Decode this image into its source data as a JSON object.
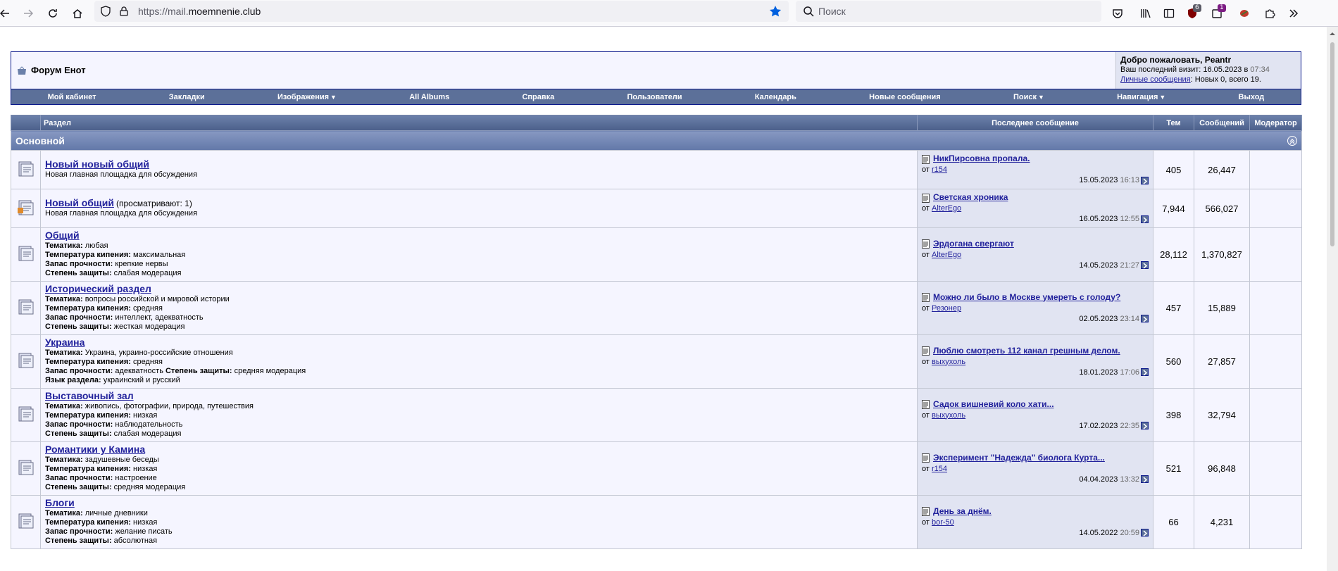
{
  "browser": {
    "url_prefix": "https://mail.",
    "url_domain": "moemnenie.club",
    "search_placeholder": "Поиск",
    "badge_1": "6",
    "badge_2": "1"
  },
  "header": {
    "forum_title": "Форум Енот",
    "welcome_line": "Добро пожаловать, Peantr",
    "last_visit_prefix": "Ваш последний визит: 16.05.2023 в ",
    "last_visit_time": "07:34",
    "pm_link": "Личные сообщения",
    "pm_counts": ": Новых 0, всего 19."
  },
  "navbar": [
    {
      "label": "Мой кабинет",
      "dropdown": false
    },
    {
      "label": "Закладки",
      "dropdown": false
    },
    {
      "label": "Изображения",
      "dropdown": true
    },
    {
      "label": "All Albums",
      "dropdown": false
    },
    {
      "label": "Справка",
      "dropdown": false
    },
    {
      "label": "Пользователи",
      "dropdown": false
    },
    {
      "label": "Календарь",
      "dropdown": false
    },
    {
      "label": "Новые сообщения",
      "dropdown": false
    },
    {
      "label": "Поиск",
      "dropdown": true
    },
    {
      "label": "Навигация",
      "dropdown": true
    },
    {
      "label": "Выход",
      "dropdown": false
    }
  ],
  "table": {
    "columns": {
      "section": "Раздел",
      "last_post": "Последнее сообщение",
      "threads": "Тем",
      "posts": "Сообщений",
      "moderator": "Модератор"
    },
    "category": "Основной",
    "by_prefix": "от ",
    "forums": [
      {
        "name": "Новый новый общий",
        "viewers": "",
        "details": [
          {
            "label": "",
            "value": "Новая главная площадка для обсуждения"
          }
        ],
        "last_title": "НикПирсовна пропала.",
        "last_user": "r154",
        "last_date": "15.05.2023",
        "last_time": "16:13",
        "threads": "405",
        "posts": "26,447"
      },
      {
        "name": "Новый общий",
        "viewers": "(просматривают: 1)",
        "details": [
          {
            "label": "",
            "value": "Новая главная площадка для обсуждения"
          }
        ],
        "last_title": "Светская хроника",
        "last_user": "AlterEgo",
        "last_date": "16.05.2023",
        "last_time": "12:55",
        "threads": "7,944",
        "posts": "566,027"
      },
      {
        "name": "Общий",
        "viewers": "",
        "details": [
          {
            "label": "Тематика:",
            "value": "любая"
          },
          {
            "label": "Температура кипения:",
            "value": "максимальная"
          },
          {
            "label": "Запас прочности:",
            "value": "крепкие нервы"
          },
          {
            "label": "Степень защиты:",
            "value": "слабая модерация"
          }
        ],
        "last_title": "Эрдогана свергают",
        "last_user": "AlterEgo",
        "last_date": "14.05.2023",
        "last_time": "21:27",
        "threads": "28,112",
        "posts": "1,370,827"
      },
      {
        "name": "Исторический раздел",
        "viewers": "",
        "details": [
          {
            "label": "Тематика:",
            "value": "вопросы российской и мировой истории"
          },
          {
            "label": "Температура кипения:",
            "value": "средняя"
          },
          {
            "label": "Запас прочности:",
            "value": "интеллект, адекватность"
          },
          {
            "label": "Степень защиты:",
            "value": "жесткая модерация"
          }
        ],
        "last_title": "Можно ли было в Москве умереть с голоду?",
        "last_user": "Резонер",
        "last_date": "02.05.2023",
        "last_time": "23:14",
        "threads": "457",
        "posts": "15,889"
      },
      {
        "name": "Украина",
        "viewers": "",
        "details": [
          {
            "label": "Тематика:",
            "value": "Украина, украино-российские отношения"
          },
          {
            "label": "Температура кипения:",
            "value": "средняя"
          },
          {
            "label": "Запас прочности:",
            "value": "адекватность",
            "label2": "Степень защиты:",
            "value2": "средняя модерация"
          },
          {
            "label": "Язык раздела:",
            "value": "украинский и русский"
          }
        ],
        "last_title": "Люблю смотреть 112 канал грешным делом.",
        "last_user": "выхухоль",
        "last_date": "18.01.2023",
        "last_time": "17:06",
        "threads": "560",
        "posts": "27,857"
      },
      {
        "name": "Выставочный зал",
        "viewers": "",
        "details": [
          {
            "label": "Тематика:",
            "value": "живопись, фотографии, природа, путешествия"
          },
          {
            "label": "Температура кипения:",
            "value": "низкая"
          },
          {
            "label": "Запас прочности:",
            "value": "наблюдательность"
          },
          {
            "label": "Степень защиты:",
            "value": "слабая модерация"
          }
        ],
        "last_title": "Садок вишневий коло хати...",
        "last_user": "выхухоль",
        "last_date": "17.02.2023",
        "last_time": "22:35",
        "threads": "398",
        "posts": "32,794"
      },
      {
        "name": "Романтики у Камина",
        "viewers": "",
        "details": [
          {
            "label": "Тематика:",
            "value": "задушевные беседы"
          },
          {
            "label": "Температура кипения:",
            "value": "низкая"
          },
          {
            "label": "Запас прочности:",
            "value": "настроение"
          },
          {
            "label": "Степень защиты:",
            "value": "средняя модерация"
          }
        ],
        "last_title": "Эксперимент \"Надежда\" биолога Курта...",
        "last_user": "r154",
        "last_date": "04.04.2023",
        "last_time": "13:32",
        "threads": "521",
        "posts": "96,848"
      },
      {
        "name": "Блоги",
        "viewers": "",
        "details": [
          {
            "label": "Тематика:",
            "value": "личные дневники"
          },
          {
            "label": "Температура кипения:",
            "value": "низкая"
          },
          {
            "label": "Запас прочности:",
            "value": "желание писать"
          },
          {
            "label": "Степень защиты:",
            "value": "абсолютная"
          }
        ],
        "last_title": "День за днём.",
        "last_user": "bor-50",
        "last_date": "14.05.2022",
        "last_time": "20:59",
        "threads": "66",
        "posts": "4,231"
      }
    ]
  }
}
